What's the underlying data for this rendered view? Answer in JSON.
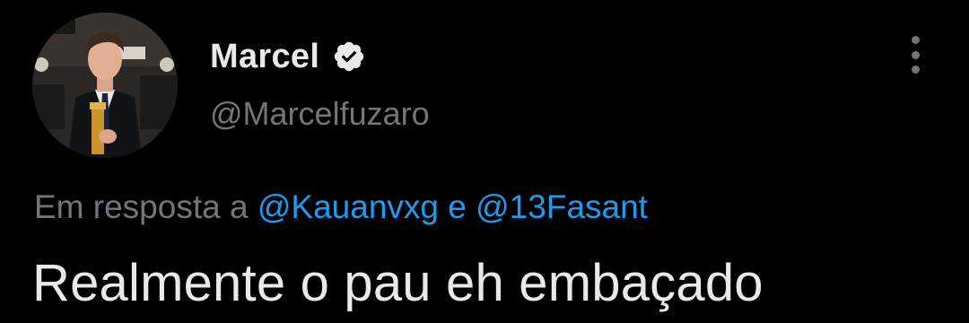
{
  "author": {
    "display_name": "Marcel",
    "handle": "@Marcelfuzaro",
    "verified_icon": "verified-badge-icon",
    "avatar_icon": "profile-photo"
  },
  "menu": {
    "icon": "more-options-icon"
  },
  "reply": {
    "prefix": "Em resposta a",
    "mention_1": "@Kauanvxg",
    "conjunction": "e",
    "mention_2": "@13Fasant"
  },
  "tweet": {
    "text": "Realmente o pau eh embaçado"
  },
  "colors": {
    "background": "#000000",
    "primary_text": "#e7e9ea",
    "secondary_text": "#71767b",
    "link": "#1d9bf0"
  }
}
